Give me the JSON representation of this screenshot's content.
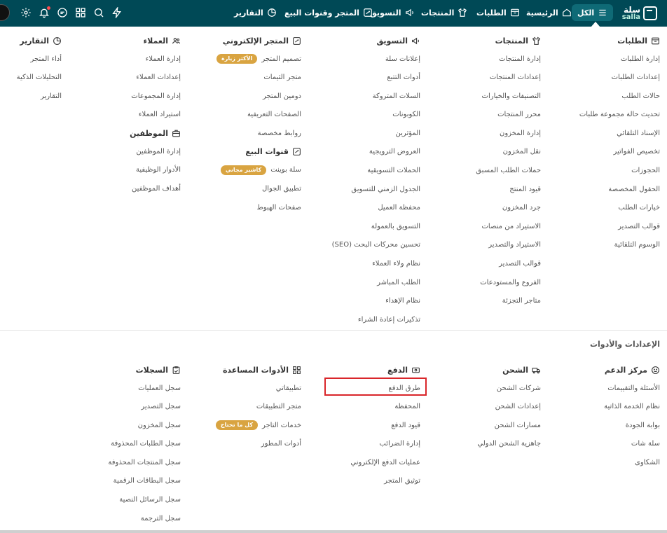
{
  "topbar": {
    "logo_ar": "سلة",
    "logo_en": "salla",
    "nav": [
      {
        "label": "الكل",
        "icon": "menu-icon",
        "active": true
      },
      {
        "label": "الرئيسية",
        "icon": "home-icon"
      },
      {
        "label": "الطلبات",
        "icon": "orders-icon"
      },
      {
        "label": "المنتجات",
        "icon": "tshirt-icon"
      },
      {
        "label": "التسويق",
        "icon": "megaphone-icon"
      },
      {
        "label": "المتجر وقنوات البيع",
        "icon": "store-icon"
      },
      {
        "label": "التقارير",
        "icon": "pie-chart-icon"
      }
    ],
    "utilities": [
      "lightning-icon",
      "search-icon",
      "apps-grid-icon",
      "chat-icon",
      "bell-icon",
      "gear-icon"
    ]
  },
  "sections": {
    "settings_title": "الإعدادات والأدوات"
  },
  "columns": {
    "orders": {
      "title": "الطلبات",
      "items": [
        "إدارة الطلبات",
        "إعدادات الطلبات",
        "حالات الطلب",
        "تحديث حالة مجموعة طلبات",
        "الإسناد التلقائي",
        "تخصيص الفواتير",
        "الحجوزات",
        "الحقول المخصصة",
        "خيارات الطلب",
        "قوالب التصدير",
        "الوسوم التلقائية"
      ]
    },
    "products": {
      "title": "المنتجات",
      "items": [
        "إدارة المنتجات",
        "إعدادات المنتجات",
        "التصنيفات والخيارات",
        "محرر المنتجات",
        "إدارة المخزون",
        "نقل المخزون",
        "حملات الطلب المسبق",
        "قيود المنتج",
        "جرد المخزون",
        "الاستيراد من منصات",
        "الاستيراد والتصدير",
        "قوالب التصدير",
        "الفروع والمستودعات",
        "متاجر التجزئة"
      ]
    },
    "marketing": {
      "title": "التسويق",
      "items": [
        "إعلانات سلة",
        "أدوات التتبع",
        "السلات المتروكة",
        "الكوبونات",
        "المؤثرين",
        "العروض الترويجية",
        "الحملات التسويقية",
        "الجدول الزمني للتسويق",
        "محفظة العميل",
        "التسويق بالعمولة",
        "تحسين محركات البحث (SEO)",
        "نظام ولاء العملاء",
        "الطلب المباشر",
        "نظام الإهداء",
        "تذكيرات إعادة الشراء"
      ]
    },
    "store": {
      "title": "المتجر الإلكتروني",
      "items": [
        {
          "label": "تصميم المتجر",
          "badge": "الأكثر زيارة"
        },
        {
          "label": "متجر الثيمات"
        },
        {
          "label": "دومين المتجر"
        },
        {
          "label": "الصفحات التعريفية"
        },
        {
          "label": "روابط مخصصة"
        }
      ]
    },
    "channels": {
      "title": "قنوات البيع",
      "items": [
        {
          "label": "سلة بوينت",
          "badge": "كاشير مجاني"
        },
        {
          "label": "تطبيق الجوال"
        },
        {
          "label": "صفحات الهبوط"
        }
      ]
    },
    "customers": {
      "title": "العملاء",
      "items": [
        "إدارة العملاء",
        "إعدادات العملاء",
        "إدارة المجموعات",
        "استيراد العملاء"
      ]
    },
    "employees": {
      "title": "الموظفين",
      "items": [
        "إدارة الموظفين",
        "الأدوار الوظيفية",
        "أهداف الموظفين"
      ]
    },
    "reports": {
      "title": "التقارير",
      "items": [
        "أداء المتجر",
        "التحليلات الذكية",
        "التقارير"
      ]
    },
    "support": {
      "title": "مركز الدعم",
      "items": [
        "الأسئلة والتقييمات",
        "نظام الخدمة الذاتية",
        "بوابة الجودة",
        "سلة شات",
        "الشكاوى"
      ]
    },
    "shipping": {
      "title": "الشحن",
      "items": [
        "شركات الشحن",
        "إعدادات الشحن",
        "مسارات الشحن",
        "جاهزية الشحن الدولي"
      ]
    },
    "payment": {
      "title": "الدفع",
      "items": [
        "طرق الدفع",
        "المحفظة",
        "قيود الدفع",
        "إدارة الضرائب",
        "عمليات الدفع الإلكتروني",
        "توثيق المتجر"
      ]
    },
    "tools": {
      "title": "الأدوات المساعدة",
      "items": [
        {
          "label": "تطبيقاتي"
        },
        {
          "label": "متجر التطبيقات"
        },
        {
          "label": "خدمات التاجر",
          "badge": "كل ما تحتاج"
        },
        {
          "label": "أدوات المطور"
        }
      ]
    },
    "logs": {
      "title": "السجلات",
      "items": [
        "سجل العمليات",
        "سجل التصدير",
        "سجل المخزون",
        "سجل الطلبات المحذوفة",
        "سجل المنتجات المحذوفة",
        "سجل البطاقات الرقمية",
        "سجل الرسائل النصية",
        "سجل الترجمة"
      ]
    }
  }
}
